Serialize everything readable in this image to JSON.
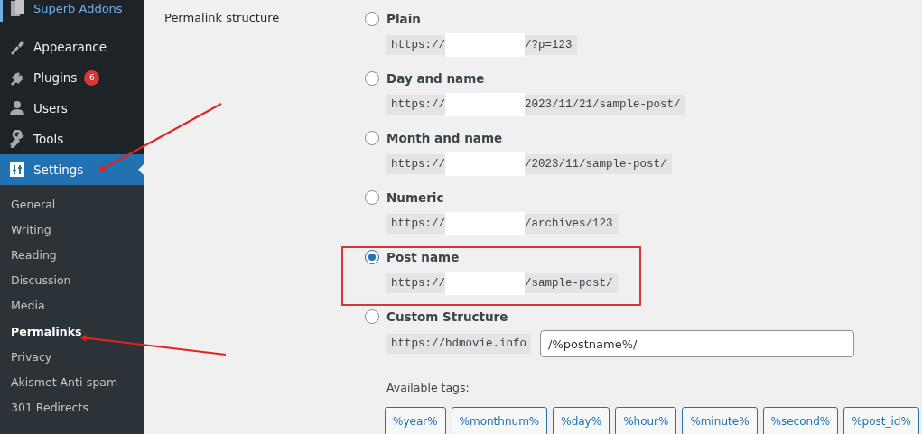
{
  "sidebar": {
    "header": {
      "label": "Superb Addons"
    },
    "menu": [
      {
        "label": "Appearance",
        "selected": false
      },
      {
        "label": "Plugins",
        "badge": "6",
        "selected": false
      },
      {
        "label": "Users",
        "selected": false
      },
      {
        "label": "Tools",
        "selected": false
      },
      {
        "label": "Settings",
        "selected": true
      }
    ],
    "submenu": [
      {
        "label": "General",
        "selected": false
      },
      {
        "label": "Writing",
        "selected": false
      },
      {
        "label": "Reading",
        "selected": false
      },
      {
        "label": "Discussion",
        "selected": false
      },
      {
        "label": "Media",
        "selected": false
      },
      {
        "label": "Permalinks",
        "selected": true
      },
      {
        "label": "Privacy",
        "selected": false
      },
      {
        "label": "Akismet Anti-spam",
        "selected": false
      },
      {
        "label": "301 Redirects",
        "selected": false
      }
    ]
  },
  "permalink_structure": {
    "label": "Permalink structure",
    "options": [
      {
        "kind": "preset",
        "label": "Plain",
        "selected": false,
        "highlighted": false,
        "url_prefix": "https://",
        "url_suffix": "/?p=123"
      },
      {
        "kind": "preset",
        "label": "Day and name",
        "selected": false,
        "highlighted": false,
        "url_prefix": "https://",
        "url_suffix": "2023/11/21/sample-post/"
      },
      {
        "kind": "preset",
        "label": "Month and name",
        "selected": false,
        "highlighted": false,
        "url_prefix": "https://",
        "url_suffix": "/2023/11/sample-post/"
      },
      {
        "kind": "preset",
        "label": "Numeric",
        "selected": false,
        "highlighted": false,
        "url_prefix": "https://",
        "url_suffix": "/archives/123"
      },
      {
        "kind": "preset",
        "label": "Post name",
        "selected": true,
        "highlighted": true,
        "url_prefix": "https://",
        "url_suffix": "/sample-post/"
      },
      {
        "kind": "custom",
        "label": "Custom Structure",
        "selected": false,
        "highlighted": false,
        "url_prefix": "https://hdmovie.info",
        "value": "/%postname%/"
      }
    ],
    "tags_label": "Available tags:",
    "tags": [
      "%year%",
      "%monthnum%",
      "%day%",
      "%hour%",
      "%minute%",
      "%second%",
      "%post_id%"
    ]
  }
}
